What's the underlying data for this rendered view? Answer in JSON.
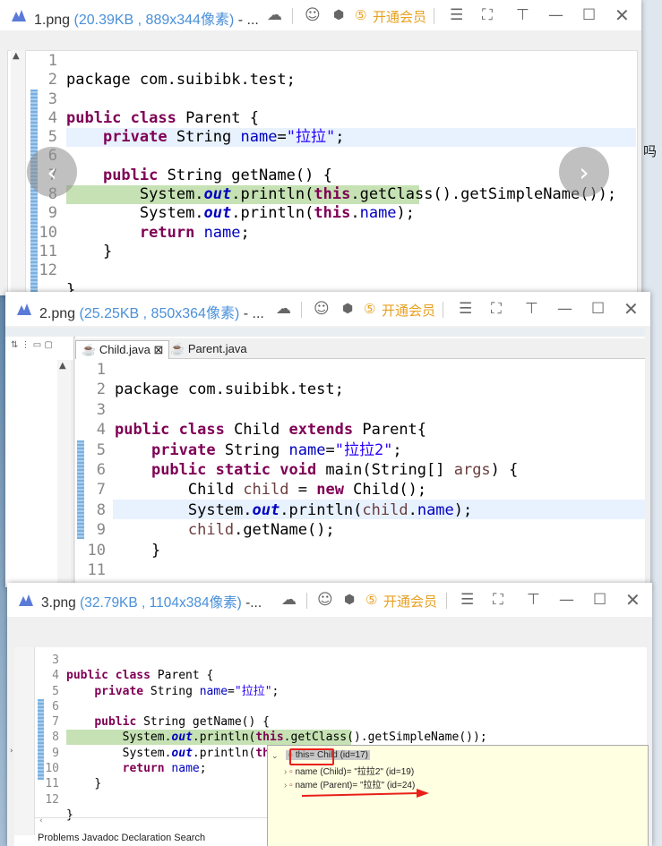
{
  "windows": [
    {
      "filename": "1.png",
      "meta": "(20.39KB , 889x344像素)",
      "suffix": " - ...",
      "vip_label": "开通会员",
      "lines": [
        "1",
        "2",
        "3",
        "4",
        "5",
        "6",
        "7",
        "8",
        "9",
        "10",
        "11",
        "12"
      ]
    },
    {
      "filename": "2.png",
      "meta": "(25.25KB , 850x364像素)",
      "suffix": " - ...",
      "vip_label": "开通会员",
      "tabs": [
        "Child.java",
        "Parent.java"
      ],
      "lines": [
        "1",
        "2",
        "3",
        "4",
        "5",
        "6",
        "7",
        "8",
        "9",
        "10",
        "11"
      ]
    },
    {
      "filename": "3.png",
      "meta": "(32.79KB , 1104x384像素)",
      "suffix": " -...",
      "vip_label": "开通会员",
      "lines": [
        "3",
        "4",
        "5",
        "6",
        "7",
        "8",
        "9",
        "10",
        "11",
        "12"
      ],
      "popup": {
        "this_row": "this= Child  (id=17)",
        "row1": "name (Child)= \"拉拉2\" (id=19)",
        "row2": "name (Parent)= \"拉拉\" (id=24)"
      },
      "bottom_tabs": "Problems  Javadoc  Declaration  Search"
    }
  ],
  "side_text": "吗",
  "code1": {
    "l1": "package com.suibibk.test;",
    "l3a": "public class",
    "l3b": " Parent {",
    "l4a": "private",
    "l4b": " String ",
    "l4c": "name",
    "l4d": "=",
    "l4e": "\"拉拉\"",
    "l4f": ";",
    "l6a": "public",
    "l6b": " String getName() {",
    "l7a": "System.",
    "l7b": "out",
    "l7c": ".println(",
    "l7d": "this",
    "l7e": ".getClass().getSimpleName());",
    "l8a": "System.",
    "l8b": "out",
    "l8c": ".println(",
    "l8d": "this",
    "l8e": ".",
    "l8f": "name",
    "l8g": ");",
    "l9a": "return",
    "l9b": " ",
    "l9c": "name",
    "l9d": ";",
    "l10": "}",
    "l12": "}"
  },
  "code2": {
    "l1": "package com.suibibk.test;",
    "l3a": "public class",
    "l3b": " Child ",
    "l3c": "extends",
    "l3d": " Parent{",
    "l4a": "private",
    "l4b": " String ",
    "l4c": "name",
    "l4d": "=",
    "l4e": "\"拉拉2\"",
    "l4f": ";",
    "l5a": "public static void",
    "l5b": " main(String[] ",
    "l5c": "args",
    "l5d": ") {",
    "l6a": "Child ",
    "l6b": "child",
    "l6c": " = ",
    "l6d": "new",
    "l6e": " Child();",
    "l7a": "System.",
    "l7b": "out",
    "l7c": ".println(",
    "l7d": "child",
    "l7e": ".",
    "l7f": "name",
    "l7g": ");",
    "l8a": "child",
    "l8b": ".getName();",
    "l9": "}",
    "l11": "}"
  }
}
